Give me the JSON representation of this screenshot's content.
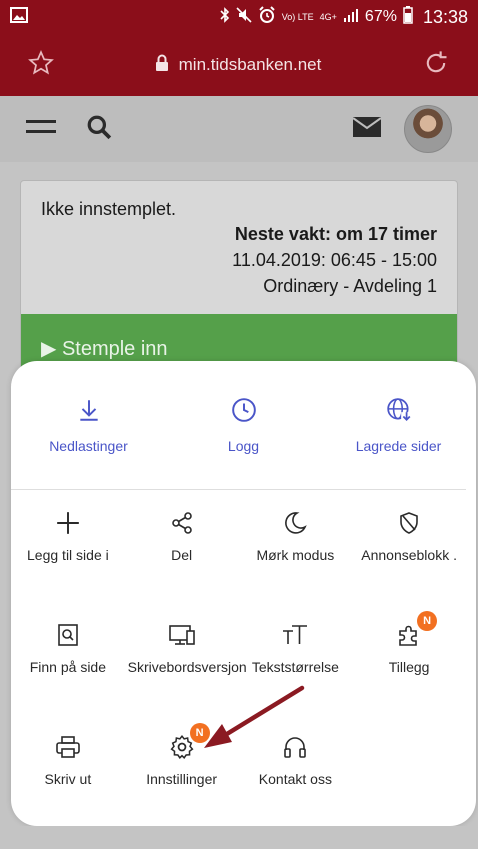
{
  "status_bar": {
    "battery_percent": "67%",
    "time": "13:38",
    "network": "4G+",
    "volte": "Vo) LTE"
  },
  "browser": {
    "url": "min.tidsbanken.net"
  },
  "card": {
    "status_text": "Ikke innstemplet.",
    "next_shift": "Neste vakt: om 17 timer",
    "shift_time": "11.04.2019: 06:45 - 15:00",
    "shift_dept": "Ordinæry   - Avdeling 1",
    "clock_in_label": "▶ Stemple inn"
  },
  "menu": {
    "top_items": [
      {
        "label": "Nedlastinger",
        "icon": "download-icon"
      },
      {
        "label": "Logg",
        "icon": "clock-icon"
      },
      {
        "label": "Lagrede sider",
        "icon": "globe-download-icon"
      }
    ],
    "grid_items": [
      {
        "label": "Legg til side i",
        "icon": "plus-icon"
      },
      {
        "label": "Del",
        "icon": "share-icon"
      },
      {
        "label": "Mørk modus",
        "icon": "moon-icon"
      },
      {
        "label": "Annonseblokk .",
        "icon": "shield-icon"
      },
      {
        "label": "Finn på side",
        "icon": "find-page-icon"
      },
      {
        "label": "Skrivebordsversjon",
        "icon": "desktop-icon"
      },
      {
        "label": "Tekststørrelse",
        "icon": "text-size-icon"
      },
      {
        "label": "Tillegg",
        "icon": "puzzle-icon",
        "badge": "N"
      },
      {
        "label": "Skriv ut",
        "icon": "printer-icon"
      },
      {
        "label": "Innstillinger",
        "icon": "gear-icon",
        "badge": "N"
      },
      {
        "label": "Kontakt oss",
        "icon": "headset-icon"
      }
    ]
  },
  "colors": {
    "brand": "#8b0e1a",
    "accent": "#4a55c8",
    "clock_in": "#55a04a",
    "badge": "#f27021",
    "arrow": "#8b1a22"
  }
}
